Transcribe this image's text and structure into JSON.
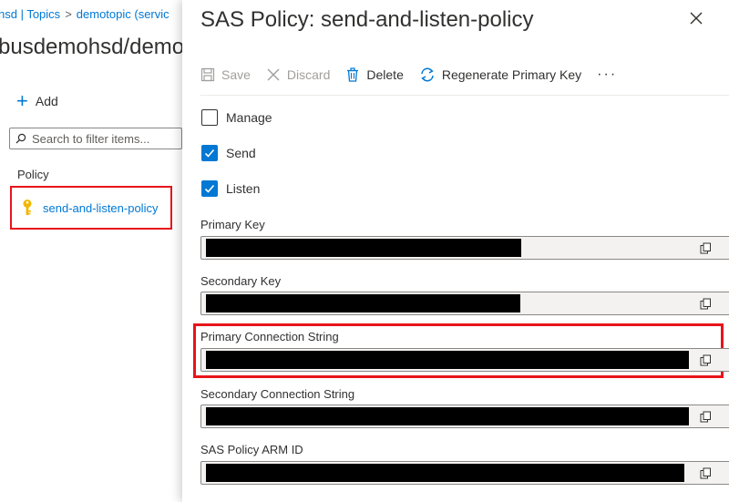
{
  "breadcrumb": {
    "item1": "hsd | Topics",
    "separator": ">",
    "item2": "demotopic (servic"
  },
  "background_title": "busdemohsd/demo",
  "left": {
    "add_label": "Add",
    "filter_placeholder": "Search to filter items...",
    "policy_header": "Policy",
    "policy_name": "send-and-listen-policy"
  },
  "panel": {
    "title": "SAS Policy: send-and-listen-policy",
    "toolbar": {
      "save": "Save",
      "discard": "Discard",
      "delete": "Delete",
      "regenerate": "Regenerate Primary Key",
      "more": "···"
    },
    "checkboxes": [
      {
        "label": "Manage",
        "checked": false
      },
      {
        "label": "Send",
        "checked": true
      },
      {
        "label": "Listen",
        "checked": true
      }
    ],
    "fields": {
      "primary_key": "Primary Key",
      "secondary_key": "Secondary Key",
      "primary_connection_string": "Primary Connection String",
      "secondary_connection_string": "Secondary Connection String",
      "arm_id": "SAS Policy ARM ID"
    }
  },
  "colors": {
    "accent": "#0078d4",
    "highlight": "#e8141a",
    "key_icon": "#f2b700"
  },
  "icons": [
    "plus-icon",
    "search-icon",
    "key-icon",
    "close-icon",
    "save-icon",
    "discard-icon",
    "delete-icon",
    "regenerate-icon",
    "more-icon",
    "checkmark-icon",
    "copy-icon"
  ]
}
